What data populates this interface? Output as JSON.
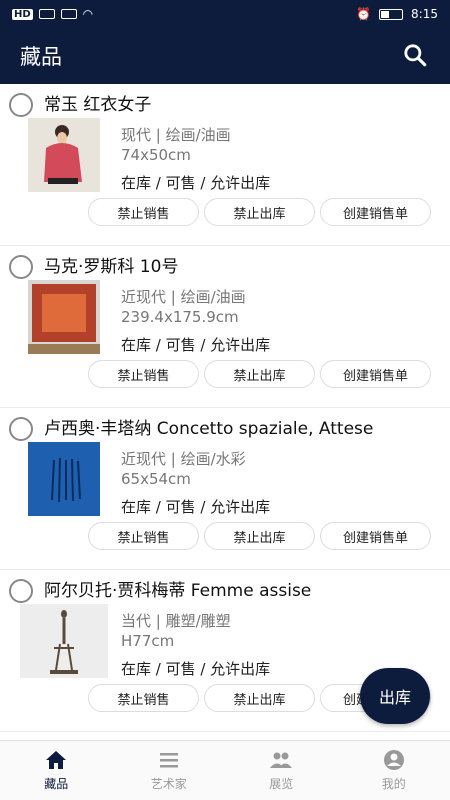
{
  "statusbar": {
    "time": "8:15",
    "network_label": "HD"
  },
  "appbar": {
    "title": "藏品"
  },
  "items": [
    {
      "name": "常玉 红衣女子",
      "period_medium": "现代 | 绘画/油画",
      "size": "74x50cm",
      "status": "在库 / 可售 / 允许出库"
    },
    {
      "name": "马克·罗斯科 10号",
      "period_medium": "近现代 | 绘画/油画",
      "size": "239.4x175.9cm",
      "status": "在库 / 可售 / 允许出库"
    },
    {
      "name": "卢西奥·丰塔纳 Concetto spaziale, Attese",
      "period_medium": "近现代 | 绘画/水彩",
      "size": "65x54cm",
      "status": "在库 / 可售 / 允许出库"
    },
    {
      "name": "阿尔贝托·贾科梅蒂 Femme assise",
      "period_medium": "当代 | 雕塑/雕塑",
      "size": "H77cm",
      "status": "在库 / 可售 / 允许出库"
    }
  ],
  "actions": {
    "disable_sale": "禁止销售",
    "disable_outbound": "禁止出库",
    "create_sale": "创建销售单"
  },
  "fab": {
    "label": "出库"
  },
  "tabs": [
    {
      "label": "藏品"
    },
    {
      "label": "艺术家"
    },
    {
      "label": "展览"
    },
    {
      "label": "我的"
    }
  ],
  "colors": {
    "primary": "#0d1c3d"
  }
}
